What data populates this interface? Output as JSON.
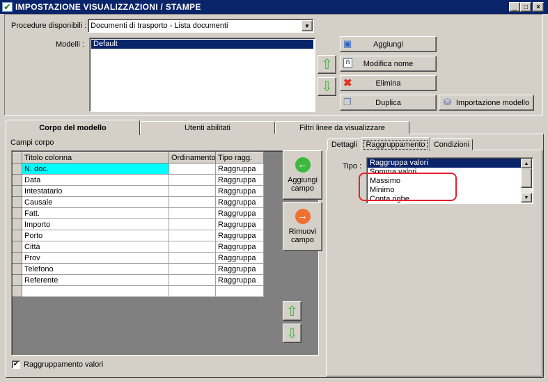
{
  "window": {
    "title": "IMPOSTAZIONE VISUALIZZAZIONI / STAMPE",
    "minimize": "_",
    "maximize": "□",
    "close": "×"
  },
  "top": {
    "procedure_label": "Procedure disponibili :",
    "procedure_value": "Documenti di trasporto - Lista documenti",
    "modelli_label": "Modelli :",
    "modelli": [
      "Default"
    ],
    "buttons": {
      "add": "Aggiungi",
      "rename": "Modifica nome",
      "delete": "Elimina",
      "duplicate": "Duplica",
      "import": "Importazione modello"
    }
  },
  "tabs": [
    "Corpo del modello",
    "Utenti abilitati",
    "Filtri linee da visualizzare"
  ],
  "body": {
    "campi_label": "Campi corpo",
    "columns": [
      "Titolo colonna",
      "Ordinamento",
      "Tipo ragg."
    ],
    "rows": [
      [
        "N. doc.",
        "",
        "Raggruppa"
      ],
      [
        "Data",
        "",
        "Raggruppa"
      ],
      [
        "Intestatario",
        "",
        "Raggruppa"
      ],
      [
        "Causale",
        "",
        "Raggruppa"
      ],
      [
        "Fatt.",
        "",
        "Raggruppa"
      ],
      [
        "Importo",
        "",
        "Raggruppa"
      ],
      [
        "Porto",
        "",
        "Raggruppa"
      ],
      [
        "Città",
        "",
        "Raggruppa"
      ],
      [
        "Prov",
        "",
        "Raggruppa"
      ],
      [
        "Telefono",
        "",
        "Raggruppa"
      ],
      [
        "Referente",
        "",
        "Raggruppa"
      ]
    ],
    "add_field": "Aggiungi campo",
    "remove_field": "Rimuovi campo",
    "checkbox_label": "Raggruppamento valori",
    "checkbox_checked": true
  },
  "subtabs": [
    "Dettagli",
    "Raggruppamento",
    "Condizioni"
  ],
  "raggruppamento": {
    "tipo_label": "Tipo :",
    "options": [
      "Raggruppa valori",
      "Somma valori",
      "Massimo",
      "Minimo",
      "Conta righe"
    ],
    "selected": "Raggruppa valori"
  },
  "colors": {
    "title": "#0a246a",
    "selection": "#0a246a",
    "row_highlight": "#00ffff",
    "annotation": "#e8202a"
  }
}
